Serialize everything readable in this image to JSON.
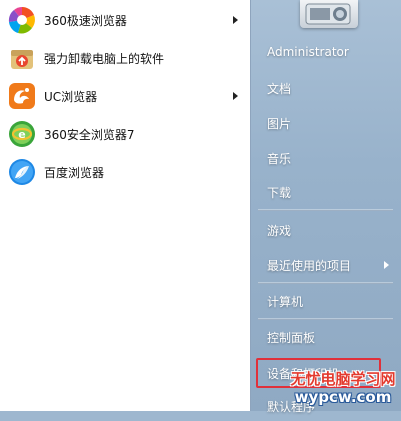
{
  "programs": [
    {
      "label": "360极速浏览器",
      "icon": "360-speed-browser-icon",
      "submenu": true
    },
    {
      "label": "强力卸载电脑上的软件",
      "icon": "uninstall-software-icon",
      "submenu": false
    },
    {
      "label": "UC浏览器",
      "icon": "uc-browser-icon",
      "submenu": true
    },
    {
      "label": "360安全浏览器7",
      "icon": "360-safe-browser-icon",
      "submenu": false
    },
    {
      "label": "百度浏览器",
      "icon": "baidu-browser-icon",
      "submenu": false
    }
  ],
  "right_menu": [
    {
      "label": "Administrator"
    },
    {
      "label": "文档"
    },
    {
      "label": "图片"
    },
    {
      "label": "音乐"
    },
    {
      "label": "下载"
    },
    {
      "label": "游戏"
    },
    {
      "label": "最近使用的项目",
      "submenu": true
    },
    {
      "label": "计算机"
    },
    {
      "label": "控制面板"
    },
    {
      "label": "设备和打印机"
    },
    {
      "label": "默认程序"
    }
  ],
  "watermark": {
    "line1": "无忧电脑学习网",
    "line2": "wypcw.com"
  },
  "colors": {
    "highlight": "#e0303a",
    "right_pane": "#9eb7cf"
  }
}
